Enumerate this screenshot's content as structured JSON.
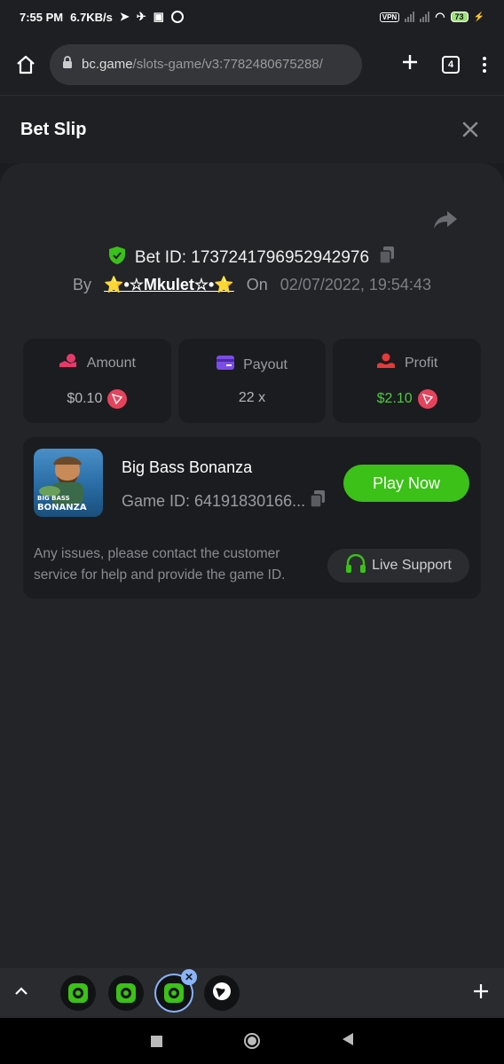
{
  "status_bar": {
    "time": "7:55 PM",
    "speed": "6.7KB/s",
    "vpn": "VPN",
    "battery": "73"
  },
  "browser": {
    "url_host": "bc.game",
    "url_path": "/slots-game/v3:7782480675288/",
    "tab_count": "4"
  },
  "header": {
    "title": "Bet Slip"
  },
  "bet": {
    "id_label": "Bet ID: 1737241796952942976",
    "by_label": "By",
    "username": "⭐•☆Mkulet☆•⭐",
    "on_label": "On",
    "date": "02/07/2022, 19:54:43"
  },
  "stats": [
    {
      "label": "Amount",
      "value": "$0.10"
    },
    {
      "label": "Payout",
      "value": "22 x"
    },
    {
      "label": "Profit",
      "value": "$2.10"
    }
  ],
  "game": {
    "name": "Big Bass Bonanza",
    "id_text": "Game ID: 64191830166...",
    "play_label": "Play Now",
    "thumb_line1": "BIG BASS",
    "thumb_line2": "BONANZA",
    "issue_text": "Any issues, please contact the customer service for help and provide the game ID.",
    "support_label": "Live Support"
  },
  "colors": {
    "accent_green": "#3bc117",
    "profit_green": "#4ccb3d",
    "coin_red": "#e7425c",
    "background": "#1b1c1f"
  }
}
